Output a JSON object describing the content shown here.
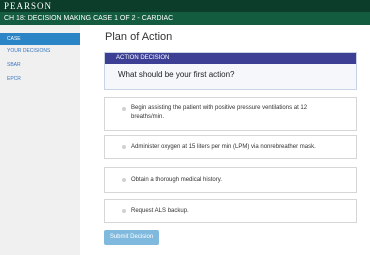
{
  "brand": "PEARSON",
  "course_title": "CH 18: DECISION MAKING CASE 1 OF 2 - CARDIAC",
  "sidebar": {
    "items": [
      {
        "label": "CASE"
      },
      {
        "label": "YOUR DECISIONS"
      },
      {
        "label": "SBAR"
      },
      {
        "label": "EPCR"
      }
    ]
  },
  "main": {
    "title": "Plan of Action",
    "question": {
      "header": "ACTION DECISION",
      "text": "What should be your first action?"
    },
    "options": [
      {
        "label_line1": "Begin assisting the patient with positive pressure ventilations at 12",
        "label_line2": "breaths/min."
      },
      {
        "label_line1": "Administer oxygen at 15 liters per min (LPM) via nonrebreather mask.",
        "label_line2": ""
      },
      {
        "label_line1": "Obtain a thorough medical history.",
        "label_line2": ""
      },
      {
        "label_line1": "Request ALS backup.",
        "label_line2": ""
      }
    ],
    "submit_label": "Submit Decision"
  }
}
